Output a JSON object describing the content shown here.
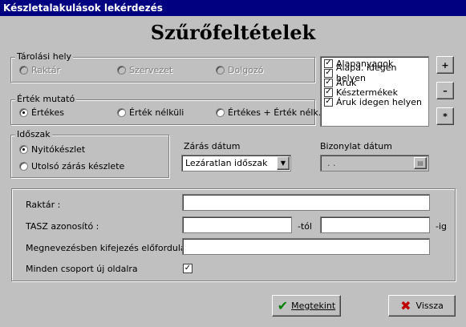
{
  "window": {
    "title": "Készletalakulások lekérdezés"
  },
  "page": {
    "heading": "Szűrőfeltételek"
  },
  "storage": {
    "legend": "Tárolási hely",
    "options": [
      "Raktár",
      "Szervezet",
      "Dolgozó"
    ]
  },
  "value_indicator": {
    "legend": "Érték mutató",
    "options": [
      "Értékes",
      "Érték nélküli",
      "Értékes + Érték nélk."
    ],
    "selected": "Értékes"
  },
  "period": {
    "legend": "Időszak",
    "options": [
      "Nyitókészlet",
      "Utolsó zárás készlete"
    ],
    "selected": "Nyitókészlet"
  },
  "closing_date": {
    "label": "Zárás dátum",
    "value": "Lezáratlan időszak"
  },
  "voucher_date": {
    "label": "Bizonylat dátum",
    "value": "  .  ."
  },
  "categories": {
    "items": [
      {
        "label": "Alapanyagok",
        "checked": true
      },
      {
        "label": "Alapa. idegen helyen",
        "checked": true
      },
      {
        "label": "Áruk",
        "checked": true
      },
      {
        "label": "Késztermékek",
        "checked": true
      },
      {
        "label": "Áruk idegen helyen",
        "checked": true
      }
    ]
  },
  "side_buttons": {
    "plus": "+",
    "minus": "–",
    "star": "*"
  },
  "filters": {
    "warehouse_label": "Raktár :",
    "tasz_label": "TASZ azonosító :",
    "from_suffix": "-tól",
    "to_suffix": "-ig",
    "expression_label": "Megnevezésben kifejezés előfordulás :",
    "new_page_label": "Minden csoport új oldalra",
    "new_page_checked": true
  },
  "buttons": {
    "view": "Megtekint",
    "back": "Vissza"
  },
  "colors": {
    "titlebar": "#000080",
    "face": "#c0c0c0",
    "ok_green": "#008000",
    "cancel_red": "#c00000"
  }
}
